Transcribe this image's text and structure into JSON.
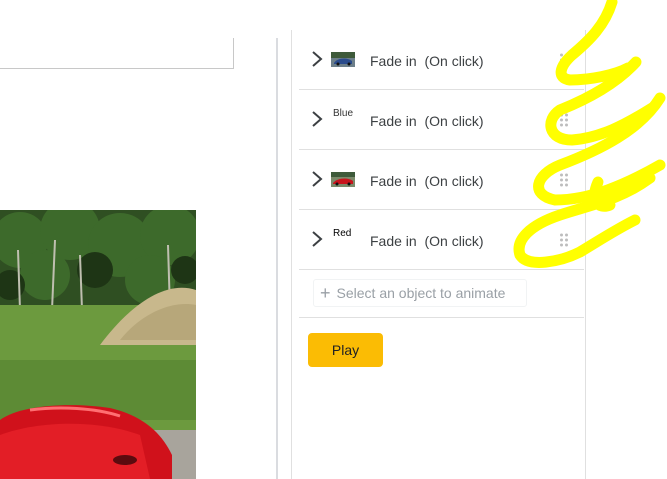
{
  "colors": {
    "accent_play": "#fbbc04",
    "scribble": "#ffff00",
    "divider": "#e0e0e0"
  },
  "animations": [
    {
      "thumb_type": "car-image-blue",
      "thumb_text": "",
      "label": "Fade in  (On click)"
    },
    {
      "thumb_type": "text",
      "thumb_text": "Blue",
      "label": "Fade in  (On click)"
    },
    {
      "thumb_type": "car-image-red",
      "thumb_text": "",
      "label": "Fade in  (On click)"
    },
    {
      "thumb_type": "text",
      "thumb_text": "Red",
      "label": "Fade in  (On click)"
    }
  ],
  "add_object": {
    "label": "Select an object to animate"
  },
  "play": {
    "label": "Play"
  }
}
